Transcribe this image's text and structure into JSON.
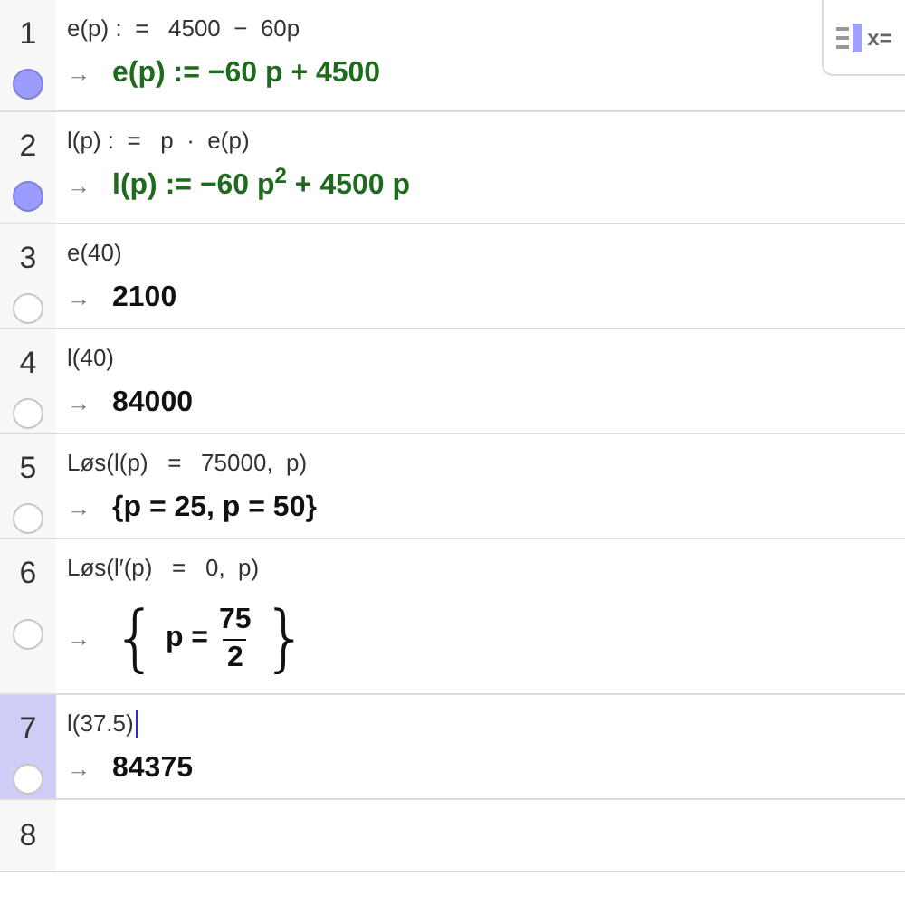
{
  "toggle_button": {
    "label": "x="
  },
  "rows": [
    {
      "number": "1",
      "input": "e(p) :  =   4500  −  60p",
      "arrow": "→",
      "output": {
        "kind": "text",
        "definition": true,
        "text": "e(p) := −60 p + 4500"
      },
      "visible": true,
      "selected": false
    },
    {
      "number": "2",
      "input": "l(p) :  =   p  ·  e(p)",
      "arrow": "→",
      "output": {
        "kind": "text",
        "definition": true,
        "text": "l(p) := −60 p$^{2}$ + 4500 p"
      },
      "visible": true,
      "selected": false
    },
    {
      "number": "3",
      "input": "e(40)",
      "arrow": "→",
      "output": {
        "kind": "text",
        "definition": false,
        "text": "2100"
      },
      "visible": false,
      "selected": false
    },
    {
      "number": "4",
      "input": "l(40)",
      "arrow": "→",
      "output": {
        "kind": "text",
        "definition": false,
        "text": "84000"
      },
      "visible": false,
      "selected": false
    },
    {
      "number": "5",
      "input": "Løs(l(p)   =   75000,  p)",
      "arrow": "→",
      "output": {
        "kind": "text",
        "definition": false,
        "text": "{p = 25, p = 50}"
      },
      "visible": false,
      "selected": false
    },
    {
      "number": "6",
      "input": "Løs(l′(p)   =   0,  p)",
      "arrow": "→",
      "output": {
        "kind": "fraction",
        "definition": false,
        "open": "{",
        "lhs": "p =",
        "numerator": "75",
        "denominator": "2",
        "close": "}"
      },
      "visible": false,
      "selected": false
    },
    {
      "number": "7",
      "input": "l(37.5)",
      "arrow": "→",
      "output": {
        "kind": "text",
        "definition": false,
        "text": "84375"
      },
      "visible": false,
      "selected": true
    },
    {
      "number": "8",
      "selected": false
    }
  ]
}
